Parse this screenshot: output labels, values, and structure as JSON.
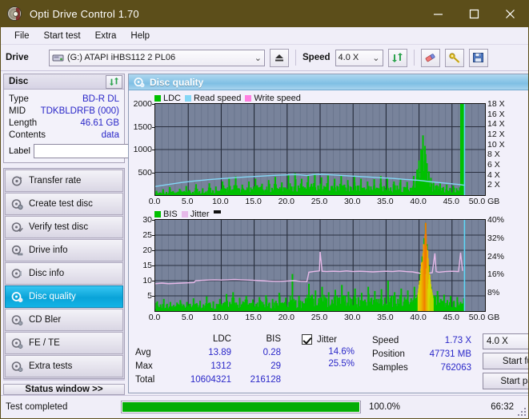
{
  "window": {
    "title": "Opti Drive Control 1.70",
    "icon": "disc-icon",
    "minimize": "minimize-icon",
    "maximize": "maximize-icon",
    "close": "close-icon",
    "titlebar_color": "#5c4e1a"
  },
  "menu": {
    "items": [
      "File",
      "Start test",
      "Extra",
      "Help"
    ]
  },
  "toolbar": {
    "drive_label": "Drive",
    "drive_value": "(G:)  ATAPI iHBS112  2 PL06",
    "eject_icon": "eject-icon",
    "speed_label": "Speed",
    "speed_value": "4.0 X",
    "refresh_icon": "refresh-icon",
    "eraser_icon": "eraser-icon",
    "key_icon": "key-icon",
    "save_icon": "save-icon"
  },
  "disc": {
    "group_title": "Disc",
    "refresh_icon": "refresh-icon",
    "rows": [
      {
        "key": "Type",
        "value": "BD-R DL"
      },
      {
        "key": "MID",
        "value": "TDKBLDRFB (000)"
      },
      {
        "key": "Length",
        "value": "46.61 GB"
      },
      {
        "key": "Contents",
        "value": "data"
      }
    ],
    "label_key": "Label",
    "label_value": "",
    "label_placeholder": "",
    "label_button_icon": "disc-icon"
  },
  "nav": {
    "items": [
      {
        "label": "Transfer rate",
        "icon": "transfer-icon",
        "active": false
      },
      {
        "label": "Create test disc",
        "icon": "create-disc-icon",
        "active": false
      },
      {
        "label": "Verify test disc",
        "icon": "verify-disc-icon",
        "active": false
      },
      {
        "label": "Drive info",
        "icon": "drive-info-icon",
        "active": false
      },
      {
        "label": "Disc info",
        "icon": "disc-info-icon",
        "active": false
      },
      {
        "label": "Disc quality",
        "icon": "disc-quality-icon",
        "active": true
      },
      {
        "label": "CD Bler",
        "icon": "cd-bler-icon",
        "active": false
      },
      {
        "label": "FE / TE",
        "icon": "fe-te-icon",
        "active": false
      },
      {
        "label": "Extra tests",
        "icon": "extra-tests-icon",
        "active": false
      }
    ],
    "status_window": "Status window >>"
  },
  "panel": {
    "title": "Disc quality",
    "icon": "disc-quality-icon"
  },
  "chart_data": [
    {
      "type": "area",
      "id": "ldc-chart",
      "title": "",
      "xlabel": "GB",
      "ylabel": "",
      "legend": [
        {
          "name": "LDC",
          "color": "#00c000"
        },
        {
          "name": "Read speed",
          "color": "#84d6f5"
        },
        {
          "name": "Write speed",
          "color": "#ff7fe0"
        }
      ],
      "legend_position": "top-left",
      "grid": true,
      "plot_bg": "#78839b",
      "xlim": [
        0,
        50
      ],
      "xticks": [
        0.0,
        5.0,
        10.0,
        15.0,
        20.0,
        25.0,
        30.0,
        35.0,
        40.0,
        45.0,
        50.0
      ],
      "xticklabels": [
        "0.0",
        "5.0",
        "10.0",
        "15.0",
        "20.0",
        "25.0",
        "30.0",
        "35.0",
        "40.0",
        "45.0",
        "50.0"
      ],
      "xunit": "GB",
      "ylim": [
        0,
        2000
      ],
      "yticks": [
        500,
        1000,
        1500,
        2000
      ],
      "yticklabels": [
        "500",
        "1000",
        "1500",
        "2000"
      ],
      "y2lim": [
        0,
        18
      ],
      "y2ticks": [
        2,
        4,
        6,
        8,
        10,
        12,
        14,
        16,
        18
      ],
      "y2ticklabels": [
        "2 X",
        "4 X",
        "6 X",
        "8 X",
        "10 X",
        "12 X",
        "14 X",
        "16 X",
        "18 X"
      ],
      "end_marker_x": 46.9,
      "series": [
        {
          "name": "LDC",
          "color": "#00c000",
          "axis": "left",
          "render": "spikes",
          "x": [
            0.2,
            0.7,
            1.2,
            1.7,
            2.2,
            2.7,
            3.2,
            3.7,
            4.2,
            4.7,
            5.2,
            5.7,
            6.2,
            6.7,
            7.2,
            7.7,
            8.2,
            8.7,
            9.2,
            9.7,
            10.2,
            10.7,
            11.2,
            11.7,
            12.2,
            12.7,
            13.2,
            13.7,
            14.2,
            14.7,
            15.2,
            15.7,
            16.2,
            16.7,
            17.2,
            17.7,
            18.2,
            18.7,
            19.2,
            19.7,
            20.2,
            20.7,
            21.2,
            21.7,
            22.2,
            22.7,
            23.2,
            23.7,
            24.2,
            24.7,
            25.2,
            25.7,
            26.2,
            26.7,
            27.2,
            27.7,
            28.2,
            28.7,
            29.2,
            29.7,
            30.2,
            30.7,
            31.2,
            31.7,
            32.2,
            32.7,
            33.2,
            33.7,
            34.2,
            34.7,
            35.2,
            35.7,
            36.2,
            36.7,
            37.2,
            37.7,
            38.2,
            38.7,
            39.2,
            39.7,
            40.0,
            40.3,
            40.6,
            40.9,
            41.0,
            41.2,
            41.5,
            41.8,
            42.2,
            42.7,
            43.2,
            43.7,
            44.2,
            44.7,
            45.2,
            45.7,
            46.2,
            46.7
          ],
          "y": [
            95,
            60,
            130,
            70,
            180,
            90,
            60,
            140,
            75,
            200,
            110,
            70,
            240,
            90,
            150,
            80,
            260,
            110,
            190,
            95,
            300,
            140,
            360,
            120,
            410,
            150,
            230,
            110,
            300,
            130,
            360,
            170,
            250,
            120,
            330,
            160,
            400,
            140,
            280,
            170,
            440,
            190,
            480,
            210,
            360,
            170,
            420,
            250,
            470,
            210,
            390,
            180,
            430,
            200,
            360,
            190,
            420,
            230,
            330,
            180,
            400,
            210,
            360,
            170,
            300,
            190,
            350,
            160,
            420,
            200,
            380,
            170,
            300,
            210,
            340,
            180,
            290,
            160,
            420,
            560,
            760,
            1000,
            1312,
            1080,
            900,
            700,
            520,
            380,
            300,
            220,
            260,
            180,
            230,
            160,
            210,
            150,
            170
          ]
        },
        {
          "name": "Read speed",
          "color": "#84d6f5",
          "axis": "right",
          "render": "line",
          "x": [
            0,
            2,
            4,
            6,
            8,
            10,
            12,
            14,
            16,
            18,
            20,
            21,
            22,
            23,
            24,
            25,
            26,
            28,
            30,
            32,
            34,
            36,
            38,
            40,
            42,
            44,
            46,
            46.9
          ],
          "y": [
            1.7,
            2.1,
            2.5,
            2.8,
            3.05,
            3.25,
            3.45,
            3.6,
            3.75,
            3.9,
            4.0,
            4.05,
            4.0,
            3.85,
            4.05,
            4.1,
            4.05,
            3.9,
            3.75,
            3.6,
            3.45,
            3.3,
            3.1,
            2.9,
            2.6,
            2.35,
            2.1,
            1.95
          ]
        }
      ]
    },
    {
      "type": "area",
      "id": "bis-jitter-chart",
      "title": "",
      "xlabel": "GB",
      "ylabel": "",
      "legend": [
        {
          "name": "BIS",
          "color": "#00c000"
        },
        {
          "name": "Jitter",
          "color": "#e7b9e9"
        }
      ],
      "legend_position": "top-left",
      "grid": true,
      "plot_bg": "#78839b",
      "xlim": [
        0,
        50
      ],
      "xticks": [
        0.0,
        5.0,
        10.0,
        15.0,
        20.0,
        25.0,
        30.0,
        35.0,
        40.0,
        45.0,
        50.0
      ],
      "xticklabels": [
        "0.0",
        "5.0",
        "10.0",
        "15.0",
        "20.0",
        "25.0",
        "30.0",
        "35.0",
        "40.0",
        "45.0",
        "50.0"
      ],
      "xunit": "GB",
      "ylim": [
        0,
        30
      ],
      "yticks": [
        5,
        10,
        15,
        20,
        25,
        30
      ],
      "yticklabels": [
        "5",
        "10",
        "15",
        "20",
        "25",
        "30"
      ],
      "y2lim": [
        0,
        40
      ],
      "y2ticks": [
        8,
        16,
        24,
        32,
        40
      ],
      "y2ticklabels": [
        "8%",
        "16%",
        "24%",
        "32%",
        "40%"
      ],
      "end_marker_x": 46.9,
      "series": [
        {
          "name": "BIS",
          "color": "#00c000",
          "axis": "left",
          "render": "spikes",
          "x": [
            0.3,
            0.8,
            1.3,
            1.8,
            2.3,
            2.8,
            3.3,
            3.8,
            4.3,
            4.8,
            5.3,
            5.8,
            6.3,
            6.8,
            7.3,
            7.8,
            8.3,
            8.8,
            9.3,
            9.8,
            10.3,
            10.8,
            11.3,
            11.8,
            12.3,
            12.8,
            13.3,
            13.8,
            14.3,
            14.8,
            15.3,
            15.8,
            16.3,
            16.8,
            17.3,
            17.8,
            18.3,
            18.8,
            19.3,
            19.8,
            20.3,
            20.8,
            21.3,
            21.8,
            22.3,
            22.8,
            23.3,
            23.8,
            24.3,
            24.8,
            25.3,
            25.8,
            26.3,
            26.8,
            27.3,
            27.8,
            28.3,
            28.8,
            29.3,
            29.8,
            30.3,
            30.8,
            31.3,
            31.8,
            32.3,
            32.8,
            33.3,
            33.8,
            34.3,
            34.8,
            35.3,
            35.8,
            36.3,
            36.8,
            37.3,
            37.8,
            38.3,
            38.8,
            39.3,
            39.8,
            40.2,
            40.5,
            40.8,
            41.0,
            41.2,
            41.5,
            41.8,
            42.3,
            42.8,
            43.3,
            43.8,
            44.3,
            44.8,
            45.3,
            45.8,
            46.3,
            46.8
          ],
          "y": [
            3.2,
            2.2,
            4.0,
            2.4,
            3.0,
            2.0,
            2.8,
            3.6,
            2.2,
            3.0,
            2.4,
            4.2,
            2.6,
            3.4,
            2.2,
            4.8,
            2.8,
            3.2,
            2.4,
            4.0,
            2.6,
            5.6,
            3.0,
            6.2,
            2.8,
            4.4,
            3.2,
            5.0,
            2.6,
            3.8,
            2.4,
            4.6,
            3.0,
            5.2,
            2.8,
            4.0,
            3.4,
            6.0,
            2.8,
            4.4,
            3.0,
            12.2,
            3.6,
            5.0,
            3.2,
            4.2,
            9.0,
            5.4,
            6.8,
            4.2,
            8.0,
            4.6,
            6.2,
            3.8,
            7.0,
            4.4,
            8.6,
            5.0,
            6.4,
            4.0,
            7.4,
            4.6,
            6.0,
            3.8,
            8.0,
            4.4,
            6.6,
            4.0,
            7.2,
            4.4,
            10.0,
            5.0,
            6.2,
            4.0,
            7.4,
            4.6,
            6.8,
            4.2,
            8.0,
            5.4,
            13.0,
            18.0,
            24.0,
            29.0,
            22.0,
            15.0,
            8.0,
            5.2,
            6.6,
            4.0,
            5.4,
            3.6,
            5.0,
            3.4,
            4.6,
            3.0,
            4.2
          ]
        },
        {
          "name": "Jitter",
          "color": "#e7b9e9",
          "axis": "left",
          "render": "line",
          "x": [
            0,
            1,
            2,
            3,
            4,
            5,
            5.9,
            6.1,
            7,
            8,
            9,
            10,
            11,
            12,
            13,
            14,
            15,
            16,
            17,
            18,
            19,
            20,
            21,
            22,
            23.0,
            23.3,
            24,
            24.9,
            25.0,
            25.3,
            26,
            27,
            28,
            29,
            30,
            31,
            32,
            33,
            34,
            35,
            36,
            37,
            38,
            39,
            40,
            40.5,
            41,
            42,
            42.4,
            42.6,
            43,
            44,
            45,
            46,
            46.3,
            46.6,
            46.9
          ],
          "y": [
            9.0,
            9.2,
            9.0,
            9.1,
            9.2,
            9.3,
            9.4,
            10.0,
            10.1,
            10.2,
            10.3,
            10.2,
            10.3,
            10.4,
            10.3,
            10.2,
            10.1,
            10.0,
            9.9,
            9.8,
            9.8,
            9.9,
            10.0,
            9.8,
            9.7,
            12.8,
            13.0,
            13.2,
            19.5,
            13.1,
            13.0,
            13.1,
            13.0,
            13.2,
            13.0,
            13.1,
            13.0,
            12.9,
            13.0,
            13.1,
            13.0,
            13.2,
            13.0,
            12.9,
            12.5,
            12.3,
            12.4,
            12.6,
            19.0,
            13.0,
            12.8,
            13.0,
            13.1,
            13.0,
            19.2,
            13.2
          ]
        }
      ]
    }
  ],
  "stats": {
    "col_headers": [
      "LDC",
      "BIS"
    ],
    "row_labels": [
      "Avg",
      "Max",
      "Total"
    ],
    "ldc": [
      "13.89",
      "1312",
      "10604321"
    ],
    "bis": [
      "0.28",
      "29",
      "216128"
    ],
    "jitter_label": "Jitter",
    "jitter_checked": true,
    "jitter_avg": "14.6%",
    "jitter_max": "25.5%",
    "speed_label": "Speed",
    "speed_value": "1.73 X",
    "position_label": "Position",
    "position_value": "47731 MB",
    "samples_label": "Samples",
    "samples_value": "762063",
    "speed_select": "4.0 X",
    "start_full": "Start full",
    "start_part": "Start part"
  },
  "statusbar": {
    "text": "Test completed",
    "percent_text": "100.0%",
    "percent_value": 100,
    "time": "66:32",
    "bar_color": "#05ad05"
  }
}
